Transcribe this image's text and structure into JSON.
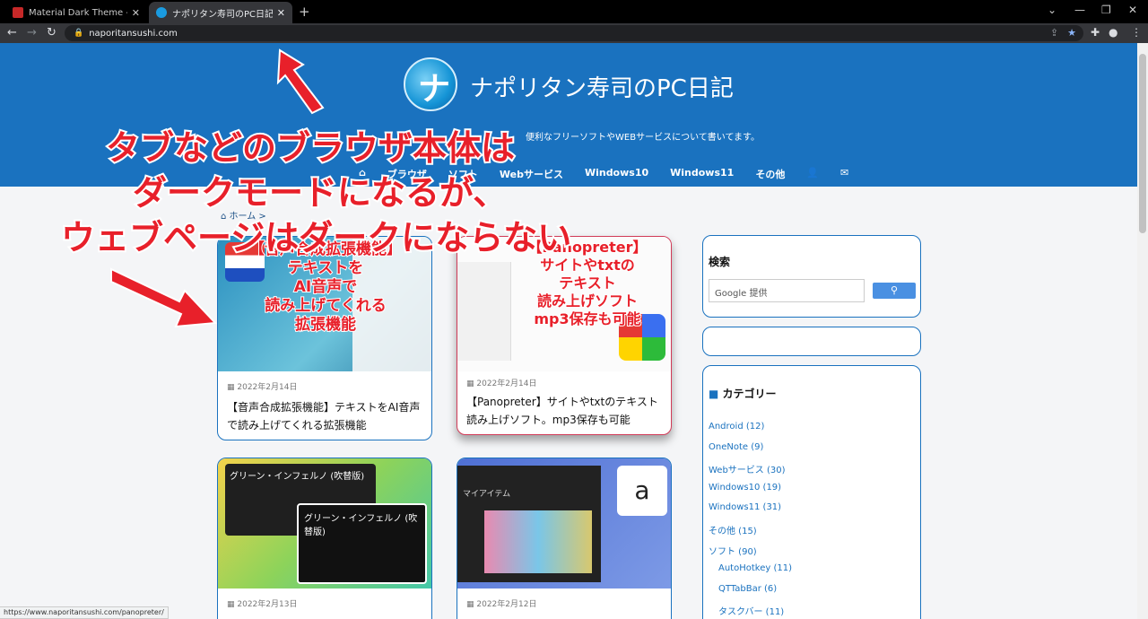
{
  "tabs": [
    {
      "title": "Material Dark Theme - Dark Chro",
      "active": false
    },
    {
      "title": "ナポリタン寿司のPC日記 | パソコン初",
      "active": true
    }
  ],
  "address": "naporitansushi.com",
  "site": {
    "title": "ナポリタン寿司のPC日記",
    "tagline": "便利なフリーソフトやWEBサービスについて書いてます。",
    "nav": [
      "ブラウザ",
      "ソフト",
      "Webサービス",
      "Windows10",
      "Windows11",
      "その他"
    ],
    "breadcrumb": "ホーム"
  },
  "annotation": {
    "line1": "タブなどのブラウザ本体は",
    "line2": "ダークモードになるが、",
    "line3": "ウェブページはダークにならない"
  },
  "cards": [
    {
      "date": "2022年2月14日",
      "title": "【音声合成拡張機能】テキストをAI音声で読み上げてくれる拡張機能",
      "overlay": [
        "【音声合成拡張機能】",
        "テキストを",
        "AI音声で",
        "読み上げてくれる",
        "拡張機能"
      ]
    },
    {
      "date": "2022年2月14日",
      "title": "【Panopreter】サイトやtxtのテキスト読み上げソフト。mp3保存も可能",
      "overlay": [
        "【Panopreter】",
        "サイトやtxtの",
        "テキスト",
        "読み上げソフト",
        "mp3保存も可能"
      ]
    },
    {
      "date": "2022年2月13日",
      "title": "",
      "screen": "グリーン・インフェルノ (吹替版)"
    },
    {
      "date": "2022年2月12日",
      "title": "",
      "screen": "マイアイテム"
    }
  ],
  "sidebar": {
    "search_title": "検索",
    "search_placeholder": "Google 提供",
    "category_title": "カテゴリー",
    "categories": [
      {
        "label": "Android (12)",
        "sub": false
      },
      {
        "label": "OneNote (9)",
        "sub": false
      },
      {
        "label": "Webサービス (30)",
        "sub": false
      },
      {
        "label": "Windows10 (19)",
        "sub": false
      },
      {
        "label": "Windows11 (31)",
        "sub": false
      },
      {
        "label": "その他 (15)",
        "sub": false
      },
      {
        "label": "ソフト (90)",
        "sub": false
      },
      {
        "label": "AutoHotkey (11)",
        "sub": true
      },
      {
        "label": "QTTabBar (6)",
        "sub": true
      },
      {
        "label": "タスクバー (11)",
        "sub": true
      }
    ]
  },
  "status_url": "https://www.naporitansushi.com/panopreter/"
}
